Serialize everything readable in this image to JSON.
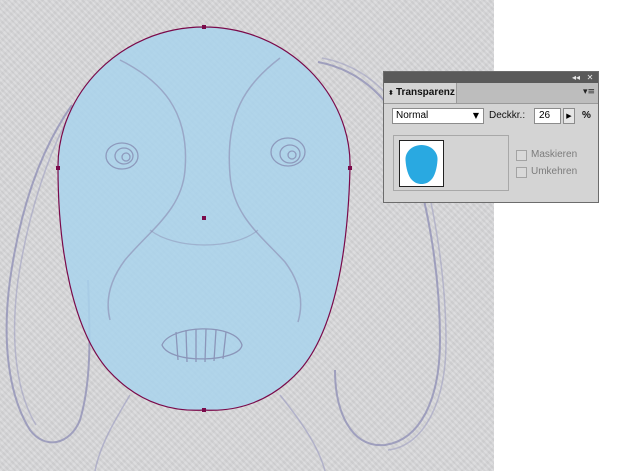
{
  "colors": {
    "selection_fill": "#a9d3ec",
    "selection_stroke": "#7a0a4a",
    "sketch_stroke": "#8a8ab0",
    "thumbnail_fill": "#29a9e1"
  },
  "panel": {
    "title_buttons": {
      "collapse_icon": "double-left-arrow-icon",
      "close_icon": "close-icon"
    },
    "tab_label": "Transparenz",
    "menu_icon": "panel-menu-icon",
    "blend_mode": {
      "value": "Normal"
    },
    "opacity": {
      "label": "Deckkr.:",
      "value": "26",
      "unit": "%"
    },
    "options": [
      {
        "label": "Maskieren",
        "checked": false,
        "enabled": false
      },
      {
        "label": "Umkehren",
        "checked": false,
        "enabled": false
      }
    ]
  }
}
